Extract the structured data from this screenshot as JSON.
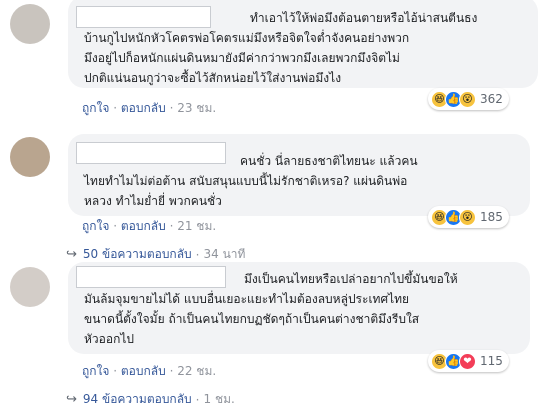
{
  "comments": [
    {
      "lines": [
        "ทำเอาไว้ให้พ่อมึงต้อนตายหรือไอ้น่าสนตีนธง",
        "บ้านกูไปหนักหัวโคตรพ่อโคตรแม่มึงหรือจิตใจต่ำจังคนอย่างพวก",
        "มึงอยู่ไปก็อหนักแผ่นดินหมายังมีค่ากว่าพวกมึงเลยพวกมึงจิตไม่",
        "ปกติแน่นอนกูว่าจะซื้อไว้สักหน่อยไว้ใส่งานพ่อมึงไง"
      ],
      "reaction_count": "362",
      "reaction_icons": [
        "laugh-icon",
        "like-icon",
        "wow-icon"
      ],
      "like": "ถูกใจ",
      "reply": "ตอบกลับ",
      "sep": "·",
      "time": "23 ชม."
    },
    {
      "lines": [
        "คนชั่ว นี่ลายธงชาติไทยนะ แล้วคน",
        "ไทยทำไมไม่ต่อต้าน สนับสนุนแบบนี้ไม่รักชาติเหรอ? แผ่นดินพ่อ",
        "หลวง ทำไมย่ำยี่ พวกคนชั่ว"
      ],
      "reaction_count": "185",
      "reaction_icons": [
        "laugh-icon",
        "like-icon",
        "wow-icon"
      ],
      "like": "ถูกใจ",
      "reply": "ตอบกลับ",
      "sep": "·",
      "time": "21 ชม.",
      "replies_label": "50 ข้อความตอบกลับ",
      "replies_time": "34 นาที"
    },
    {
      "lines": [
        "มึงเป็นคนไทยหรือเปล่าอยากไปขึ้มันขอให้",
        "มันล้มจุมขายไม่ได้ แบบอื่นเยอะแยะทำไมต้องลบหลู่ประเทศไทย",
        "ขนาดนี้ตั้งใจมั้ย ถ้าเป็นคนไทยกบฏชัดๆถ้าเป็นคนต่างชาติมึงรีบใส",
        "หัวออกไป"
      ],
      "reaction_count": "115",
      "reaction_icons": [
        "laugh-icon",
        "like-icon",
        "love-icon"
      ],
      "like": "ถูกใจ",
      "reply": "ตอบกลับ",
      "sep": "·",
      "time": "22 ชม.",
      "replies_label": "94 ข้อความตอบกลับ",
      "replies_time": "1 ชม."
    }
  ],
  "colors": {
    "bubble": "#f2f3f5",
    "link": "#365899",
    "like": "#1877f2",
    "laugh": "#f7c33e",
    "love": "#f33e58"
  }
}
